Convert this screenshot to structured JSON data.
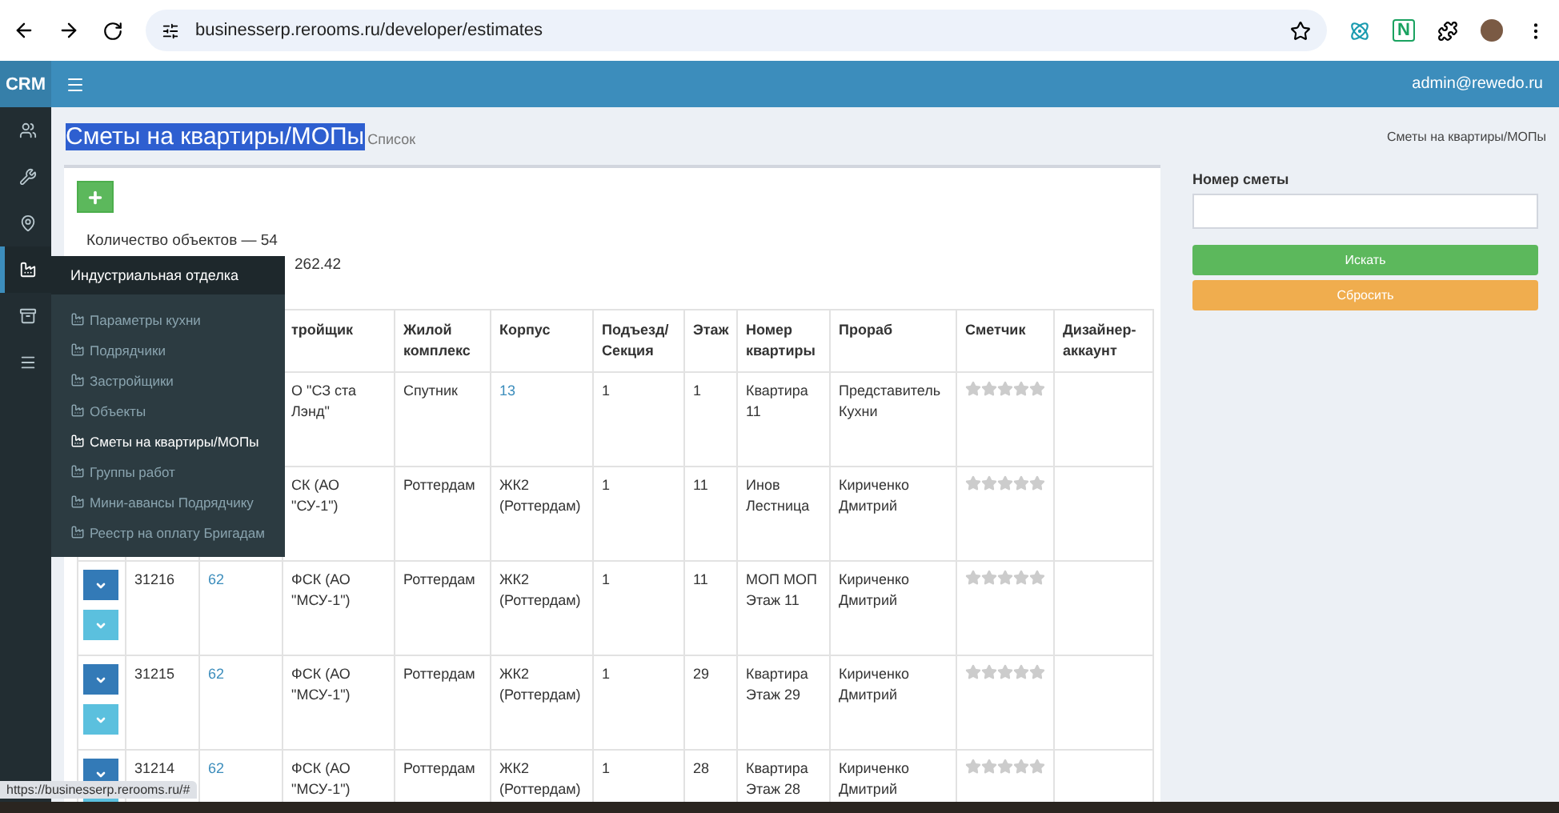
{
  "browser": {
    "url": "businesserp.rerooms.ru/developer/estimates",
    "extension_label": "N"
  },
  "header": {
    "logo": "CRM",
    "user": "admin@rewedo.ru"
  },
  "sidebar": {
    "items": [
      {
        "kind": "users",
        "selected": false
      },
      {
        "kind": "wrench",
        "selected": false
      },
      {
        "kind": "pin",
        "selected": false
      },
      {
        "kind": "factory",
        "selected": true
      },
      {
        "kind": "archive",
        "selected": false
      },
      {
        "kind": "bars",
        "selected": false
      }
    ]
  },
  "flyout": {
    "title": "Индустриальная отделка",
    "items": [
      {
        "label": "Параметры кухни",
        "selected": false
      },
      {
        "label": "Подрядчики",
        "selected": false
      },
      {
        "label": "Застройщики",
        "selected": false
      },
      {
        "label": "Объекты",
        "selected": false
      },
      {
        "label": "Сметы на квартиры/МОПы",
        "selected": true
      },
      {
        "label": "Группы работ",
        "selected": false
      },
      {
        "label": "Мини-авансы Подрядчику",
        "selected": false
      },
      {
        "label": "Реестр на оплату Бригадам",
        "selected": false
      }
    ]
  },
  "page": {
    "title": "Сметы на квартиры/МОПы",
    "subtitle": "Список",
    "breadcrumb": "Сметы на квартиры/МОПы"
  },
  "summary": {
    "count_line": "Количество объектов — 54",
    "total_value": "262.42"
  },
  "table": {
    "columns": [
      "тройщик",
      "Жилой комплекс",
      "Корпус",
      "Подъезд/ Секция",
      "Этаж",
      "Номер квартиры",
      "Прораб",
      "Сметчик",
      "Дизайнер-аккаунт"
    ],
    "rows": [
      {
        "id": "",
        "object": "",
        "builder": "О \"СЗ ста Лэнд\"",
        "complex": "Спутник",
        "building": "13",
        "entrance": "1",
        "floor": "1",
        "apartment": "Квартира 11",
        "foreman": "Представитель Кухни",
        "stars": 0
      },
      {
        "id": "",
        "object": "",
        "builder": "СК (АО \"СУ-1\")",
        "complex": "Роттердам",
        "building": "ЖК2 (Роттердам)",
        "entrance": "1",
        "floor": "11",
        "apartment": "Инов Лестница",
        "foreman": "Кириченко Дмитрий",
        "stars": 0
      },
      {
        "id": "31216",
        "object": "62",
        "builder": "ФСК (АО \"МСУ-1\")",
        "complex": "Роттердам",
        "building": "ЖК2 (Роттердам)",
        "entrance": "1",
        "floor": "11",
        "apartment": "МОП МОП Этаж 11",
        "foreman": "Кириченко Дмитрий",
        "stars": 0
      },
      {
        "id": "31215",
        "object": "62",
        "builder": "ФСК (АО \"МСУ-1\")",
        "complex": "Роттердам",
        "building": "ЖК2 (Роттердам)",
        "entrance": "1",
        "floor": "29",
        "apartment": "Квартира Этаж 29",
        "foreman": "Кириченко Дмитрий",
        "stars": 0
      },
      {
        "id": "31214",
        "object": "62",
        "builder": "ФСК (АО \"МСУ-1\")",
        "complex": "Роттердам",
        "building": "ЖК2 (Роттердам)",
        "entrance": "1",
        "floor": "28",
        "apartment": "Квартира Этаж 28",
        "foreman": "Кириченко Дмитрий",
        "stars": 0
      }
    ]
  },
  "filter": {
    "label": "Номер сметы",
    "search_button": "Искать",
    "reset_button": "Сбросить"
  },
  "status_url": "https://businesserp.rerooms.ru/#"
}
